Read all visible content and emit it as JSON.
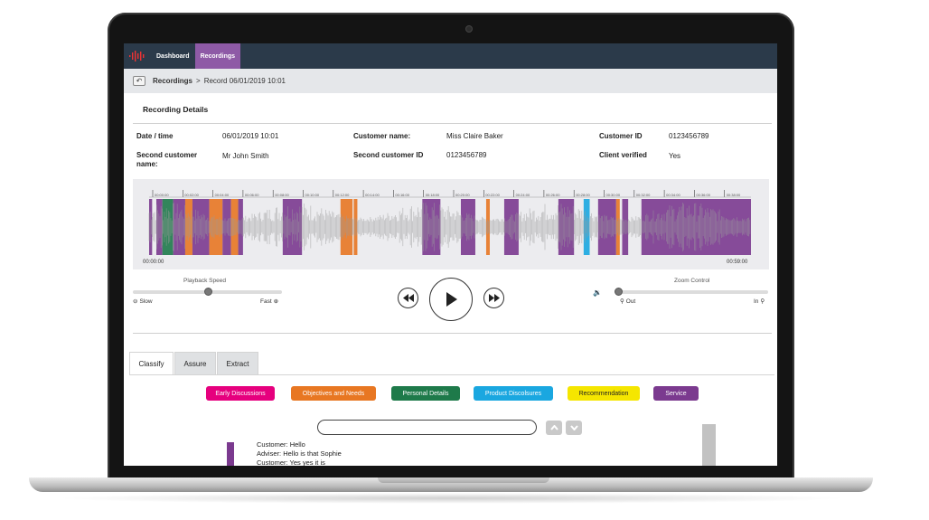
{
  "nav": {
    "logo": "waveform-logo-icon",
    "items": [
      {
        "label": "Dashboard",
        "active": false
      },
      {
        "label": "Recordings",
        "active": true
      }
    ]
  },
  "breadcrumb": {
    "back_icon": "back-arrow-icon",
    "parent": "Recordings",
    "separator": ">",
    "current": "Record 06/01/2019 10:01"
  },
  "details": {
    "title": "Recording Details",
    "fields": [
      {
        "label": "Date / time",
        "value": "06/01/2019 10:01"
      },
      {
        "label": "Customer name:",
        "value": "Miss Claire Baker"
      },
      {
        "label": "Customer ID",
        "value": "0123456789"
      },
      {
        "label": "Second customer name:",
        "value": "Mr John Smith"
      },
      {
        "label": "Second customer ID",
        "value": "0123456789"
      },
      {
        "label": "Client verified",
        "value": "Yes"
      }
    ]
  },
  "waveform": {
    "start_time": "00:00:00",
    "end_time": "00:59:00",
    "tick_labels": [
      "00:00:00",
      "00:02:00",
      "00:04:00",
      "00:06:00",
      "00:08:00",
      "00:10:00",
      "00:12:00",
      "00:14:00",
      "00:16:00",
      "00:18:00",
      "00:20:00",
      "00:22:00",
      "00:24:00",
      "00:26:00",
      "00:28:00",
      "00:30:00",
      "00:32:00",
      "00:34:00",
      "00:36:00",
      "00:38:00"
    ],
    "segments": [
      {
        "category": "Service",
        "start": 0.0,
        "end": 0.005
      },
      {
        "category": "Service",
        "start": 0.012,
        "end": 0.022
      },
      {
        "category": "Personal Details",
        "start": 0.022,
        "end": 0.04
      },
      {
        "category": "Service",
        "start": 0.04,
        "end": 0.06
      },
      {
        "category": "Objectives and Needs",
        "start": 0.06,
        "end": 0.072
      },
      {
        "category": "Service",
        "start": 0.072,
        "end": 0.1
      },
      {
        "category": "Objectives and Needs",
        "start": 0.1,
        "end": 0.122
      },
      {
        "category": "Service",
        "start": 0.122,
        "end": 0.136
      },
      {
        "category": "Objectives and Needs",
        "start": 0.136,
        "end": 0.148
      },
      {
        "category": "Service",
        "start": 0.148,
        "end": 0.156
      },
      {
        "category": "Service",
        "start": 0.222,
        "end": 0.254
      },
      {
        "category": "Objectives and Needs",
        "start": 0.318,
        "end": 0.338
      },
      {
        "category": "Objectives and Needs",
        "start": 0.34,
        "end": 0.346
      },
      {
        "category": "Service",
        "start": 0.454,
        "end": 0.484
      },
      {
        "category": "Service",
        "start": 0.518,
        "end": 0.542
      },
      {
        "category": "Objectives and Needs",
        "start": 0.56,
        "end": 0.566
      },
      {
        "category": "Service",
        "start": 0.59,
        "end": 0.614
      },
      {
        "category": "Service",
        "start": 0.68,
        "end": 0.706
      },
      {
        "category": "Product Discolsures",
        "start": 0.722,
        "end": 0.732
      },
      {
        "category": "Service",
        "start": 0.746,
        "end": 0.776
      },
      {
        "category": "Objectives and Needs",
        "start": 0.776,
        "end": 0.782
      },
      {
        "category": "Service",
        "start": 0.786,
        "end": 0.796
      },
      {
        "category": "Service",
        "start": 0.818,
        "end": 1.0
      }
    ]
  },
  "controls": {
    "playback_speed_label": "Playback Speed",
    "playback_speed": 0.5,
    "slow_label": "Slow",
    "fast_label": "Fast",
    "zoom_label": "Zoom Control",
    "zoom": 0.0,
    "out_label": "Out",
    "in_label": "In",
    "rewind_icon": "rewind-icon",
    "play_icon": "play-icon",
    "forward_icon": "fast-forward-icon",
    "volume_icon": "volume-icon"
  },
  "tabs": [
    {
      "label": "Classify",
      "active": true
    },
    {
      "label": "Assure",
      "active": false
    },
    {
      "label": "Extract",
      "active": false
    }
  ],
  "categories": [
    {
      "label": "Early Discussions",
      "color": "#e6007e",
      "text_color": "#ffffff"
    },
    {
      "label": "Objectives and Needs",
      "color": "#e87722",
      "text_color": "#ffffff"
    },
    {
      "label": "Personal Details",
      "color": "#1e7a4a",
      "text_color": "#ffffff"
    },
    {
      "label": "Product Discolsures",
      "color": "#1aa7e0",
      "text_color": "#ffffff"
    },
    {
      "label": "Recommendation",
      "color": "#f5e600",
      "text_color": "#222222"
    },
    {
      "label": "Service",
      "color": "#7b3a8f",
      "text_color": "#ffffff"
    }
  ],
  "search": {
    "value": "",
    "up_icon": "chevron-up-icon",
    "down_icon": "chevron-down-icon"
  },
  "transcript": [
    {
      "speaker": "Customer:",
      "text": "Hello"
    },
    {
      "speaker": "Adviser:",
      "text": "Hello is that Sophie"
    },
    {
      "speaker": "Customer:",
      "text": "Yes yes it is"
    }
  ]
}
